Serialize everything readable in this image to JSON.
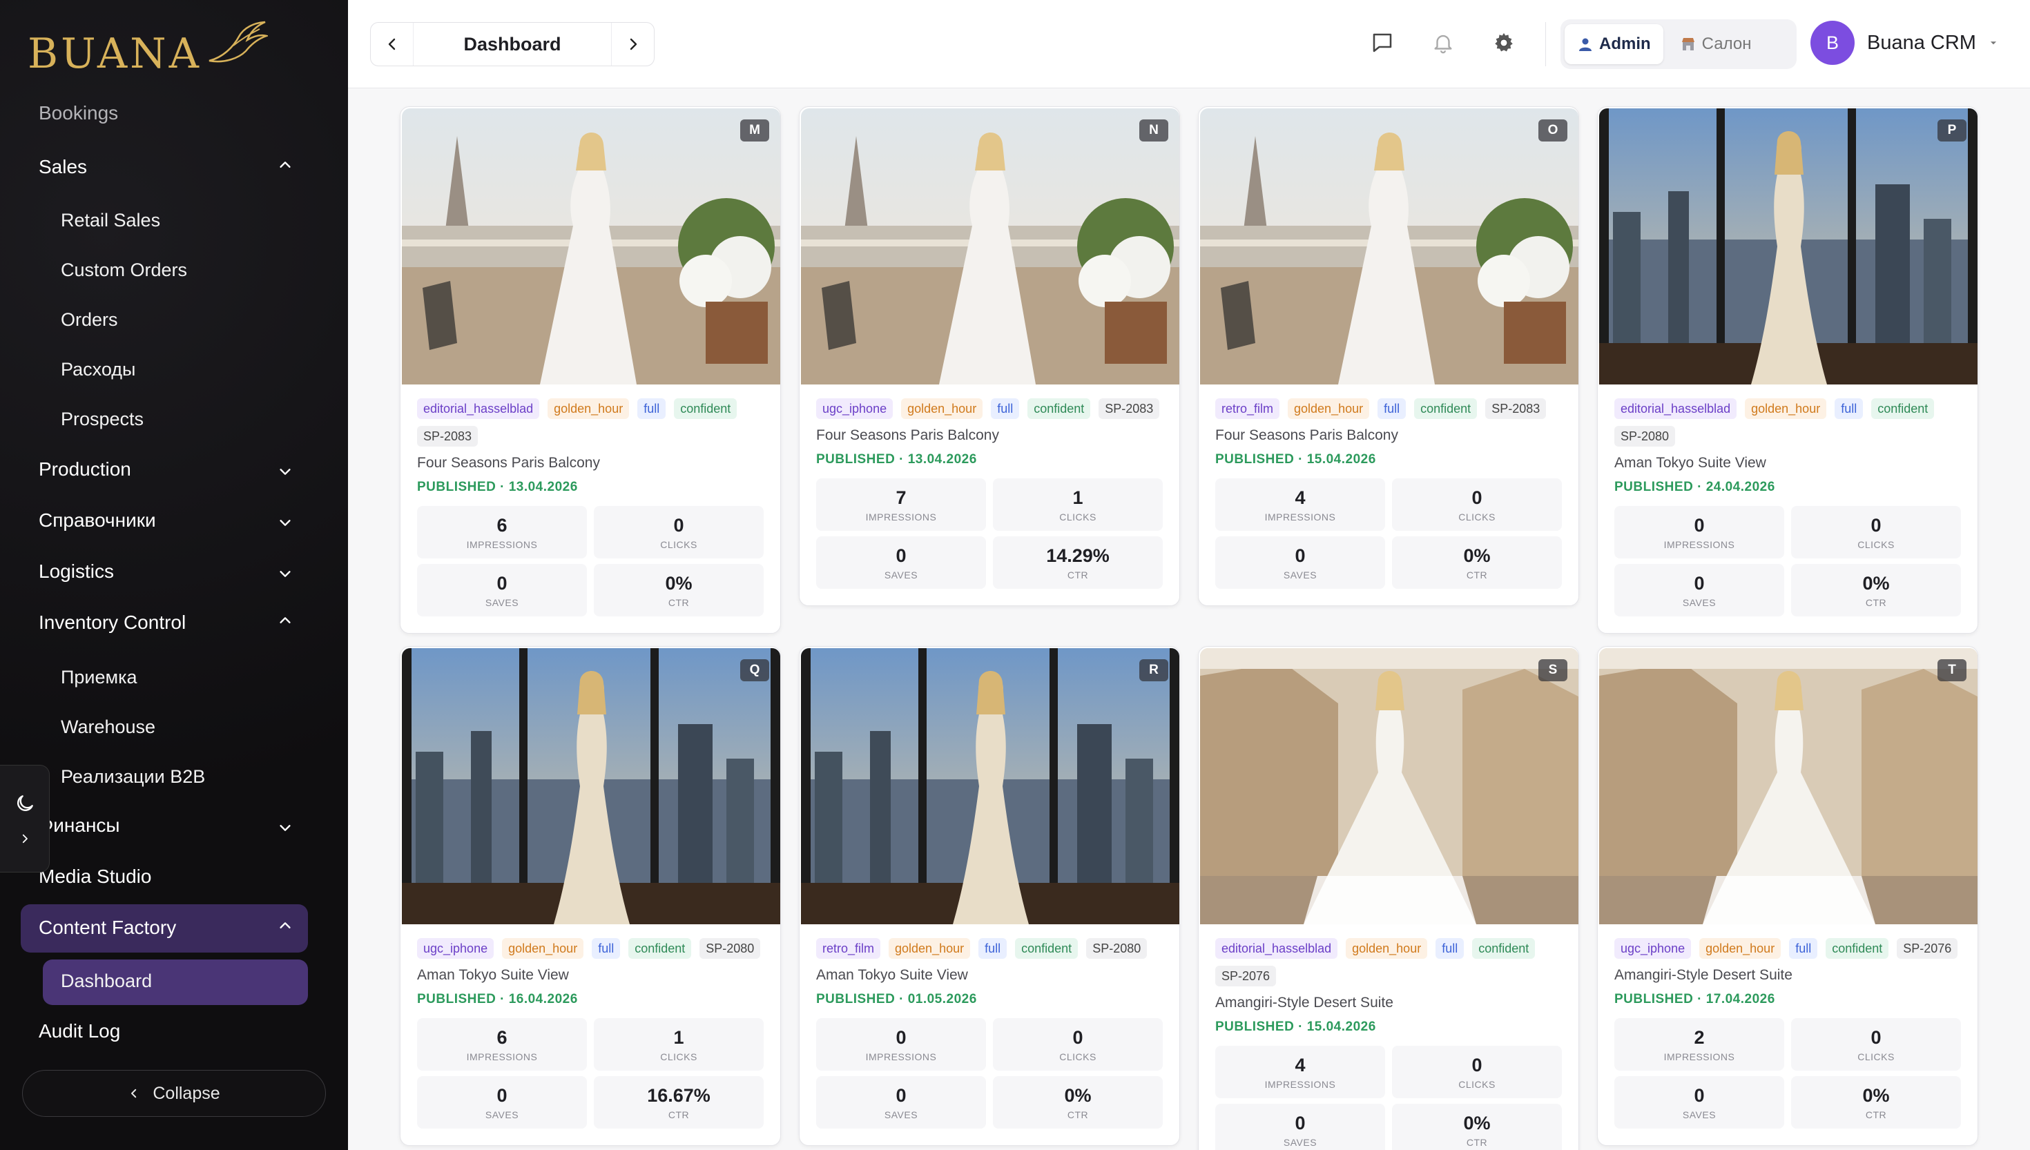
{
  "brand": {
    "logo_text": "BUANA",
    "accent": "#d8b25a"
  },
  "sidebar": {
    "partial_item": "Bookings",
    "sales": {
      "label": "Sales",
      "children": [
        "Retail Sales",
        "Custom Orders",
        "Orders",
        "Расходы",
        "Prospects"
      ]
    },
    "production": "Production",
    "spravochniki": "Справочники",
    "logistics": "Logistics",
    "inventory": {
      "label": "Inventory Control",
      "children": [
        "Приемка",
        "Warehouse",
        "Реализации B2B"
      ]
    },
    "finance": "Финансы",
    "media_studio": "Media Studio",
    "content_factory": {
      "label": "Content Factory",
      "children": [
        "Dashboard"
      ]
    },
    "audit_log": "Audit Log",
    "collapse": "Collapse"
  },
  "header": {
    "breadcrumb_title": "Dashboard",
    "roles": {
      "admin": "Admin",
      "salon": "Салон"
    },
    "user": {
      "initial": "B",
      "name": "Buana CRM"
    }
  },
  "stat_labels": {
    "impressions": "IMPRESSIONS",
    "clicks": "CLICKS",
    "saves": "SAVES",
    "ctr": "CTR"
  },
  "cards": [
    {
      "badge": "M",
      "tags": [
        "editorial_hasselblad",
        "golden_hour",
        "full",
        "confident",
        "SP-2083"
      ],
      "location": "Four Seasons Paris Balcony",
      "status": "PUBLISHED",
      "date": "13.04.2026",
      "impressions": "6",
      "clicks": "0",
      "saves": "0",
      "ctr": "0%",
      "scene": "paris"
    },
    {
      "badge": "N",
      "tags": [
        "ugc_iphone",
        "golden_hour",
        "full",
        "confident",
        "SP-2083"
      ],
      "location": "Four Seasons Paris Balcony",
      "status": "PUBLISHED",
      "date": "13.04.2026",
      "impressions": "7",
      "clicks": "1",
      "saves": "0",
      "ctr": "14.29%",
      "scene": "paris"
    },
    {
      "badge": "O",
      "tags": [
        "retro_film",
        "golden_hour",
        "full",
        "confident",
        "SP-2083"
      ],
      "location": "Four Seasons Paris Balcony",
      "status": "PUBLISHED",
      "date": "15.04.2026",
      "impressions": "4",
      "clicks": "0",
      "saves": "0",
      "ctr": "0%",
      "scene": "paris"
    },
    {
      "badge": "P",
      "tags": [
        "editorial_hasselblad",
        "golden_hour",
        "full",
        "confident",
        "SP-2080"
      ],
      "location": "Aman Tokyo Suite View",
      "status": "PUBLISHED",
      "date": "24.04.2026",
      "impressions": "0",
      "clicks": "0",
      "saves": "0",
      "ctr": "0%",
      "scene": "tokyo"
    },
    {
      "badge": "Q",
      "tags": [
        "ugc_iphone",
        "golden_hour",
        "full",
        "confident",
        "SP-2080"
      ],
      "location": "Aman Tokyo Suite View",
      "status": "PUBLISHED",
      "date": "16.04.2026",
      "impressions": "6",
      "clicks": "1",
      "saves": "0",
      "ctr": "16.67%",
      "scene": "tokyo"
    },
    {
      "badge": "R",
      "tags": [
        "retro_film",
        "golden_hour",
        "full",
        "confident",
        "SP-2080"
      ],
      "location": "Aman Tokyo Suite View",
      "status": "PUBLISHED",
      "date": "01.05.2026",
      "impressions": "0",
      "clicks": "0",
      "saves": "0",
      "ctr": "0%",
      "scene": "tokyo"
    },
    {
      "badge": "S",
      "tags": [
        "editorial_hasselblad",
        "golden_hour",
        "full",
        "confident",
        "SP-2076"
      ],
      "location": "Amangiri-Style Desert Suite",
      "status": "PUBLISHED",
      "date": "15.04.2026",
      "impressions": "4",
      "clicks": "0",
      "saves": "0",
      "ctr": "0%",
      "scene": "desert"
    },
    {
      "badge": "T",
      "tags": [
        "ugc_iphone",
        "golden_hour",
        "full",
        "confident",
        "SP-2076"
      ],
      "location": "Amangiri-Style Desert Suite",
      "status": "PUBLISHED",
      "date": "17.04.2026",
      "impressions": "2",
      "clicks": "0",
      "saves": "0",
      "ctr": "0%",
      "scene": "desert"
    }
  ]
}
